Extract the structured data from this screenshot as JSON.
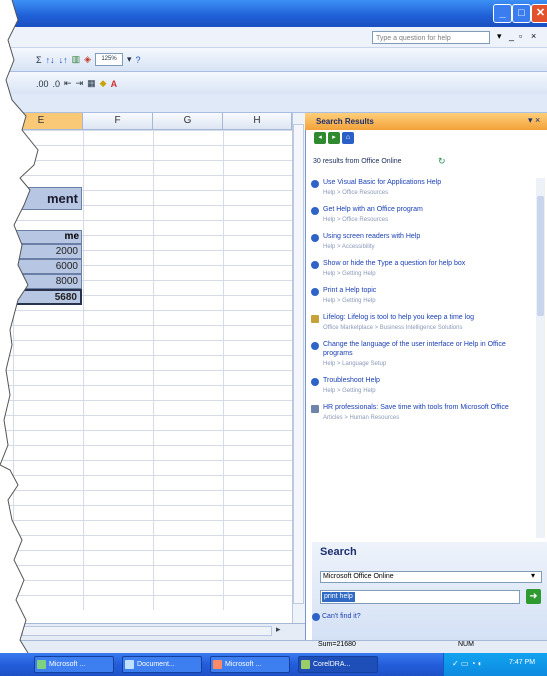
{
  "window": {
    "ask_placeholder": "Type a question for help",
    "min": "_",
    "max": "□",
    "close": "✕"
  },
  "toolbar": {
    "zoom": "125%"
  },
  "columns": [
    "E",
    "F",
    "G",
    "H"
  ],
  "sheet": {
    "title_fragment": "ment",
    "subheader_fragment": "me",
    "values": [
      "2000",
      "6000",
      "8000"
    ],
    "total": "5680"
  },
  "pane": {
    "title": "Search Results",
    "result_count": "30 results from Office Online",
    "results": [
      {
        "title": "Use Visual Basic for Applications Help",
        "sub": "Help > Office Resources",
        "icon": "help-globe-icon"
      },
      {
        "title": "Get Help with an Office program",
        "sub": "Help > Office Resources",
        "icon": "help-globe-icon"
      },
      {
        "title": "Using screen readers with Help",
        "sub": "Help > Accessibility",
        "icon": "help-globe-icon"
      },
      {
        "title": "Show or hide the Type a question for help box",
        "sub": "Help > Getting Help",
        "icon": "help-globe-icon"
      },
      {
        "title": "Print a Help topic",
        "sub": "Help > Getting Help",
        "icon": "help-globe-icon"
      },
      {
        "title": "Lifelog: Lifelog is tool to help you keep a time log",
        "sub": "Office Marketplace > Business Intelligence Solutions",
        "icon": "marketplace-icon"
      },
      {
        "title": "Change the language of the user interface or Help in Office programs",
        "sub": "Help > Language Setup",
        "icon": "help-globe-icon"
      },
      {
        "title": "Troubleshoot Help",
        "sub": "Help > Getting Help",
        "icon": "help-globe-icon"
      },
      {
        "title": "HR professionals: Save time with tools from Microsoft Office",
        "sub": "Articles > Human Resources",
        "icon": "article-icon"
      }
    ],
    "search_heading": "Search",
    "search_scope": "Microsoft Office Online",
    "search_query": "print help",
    "cant_find": "Can't find it?"
  },
  "status": {
    "sum": "Sum=21680",
    "mode": "NUM"
  },
  "taskbar": {
    "buttons": [
      "Microsoft ...",
      "Document...",
      "Microsoft ...",
      "CorelDRA..."
    ],
    "clock": "7:47 PM"
  }
}
